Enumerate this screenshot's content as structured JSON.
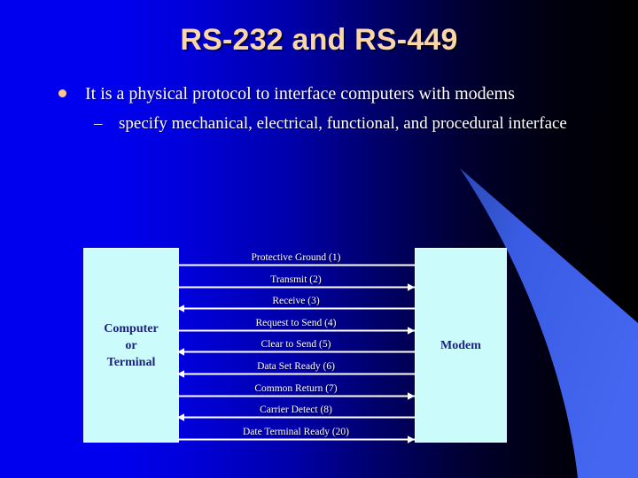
{
  "slide": {
    "title": "RS-232 and RS-449",
    "title_color": "#FBD7A8",
    "background_left_color": "#0000EE",
    "background_right_color": "#000000",
    "accent_wedge_color": "#3B5EE8"
  },
  "body": {
    "bullet_glyph": "bullet-dot",
    "bullet_text": "It is a physical protocol to interface computers with modems",
    "dash_glyph": "–",
    "sub_text": "specify mechanical, electrical, functional, and procedural interface"
  },
  "diagram": {
    "left_box_label": "Computer\nor\nTerminal",
    "left_box_lines": [
      "Computer",
      "or",
      "Terminal"
    ],
    "right_box_label": "Modem",
    "box_fill_color": "#CCFBFB",
    "box_text_color": "#1A237E",
    "line_color": "#FFFFFF",
    "signals": [
      {
        "label": "Protective Ground (1)",
        "pin": "1",
        "direction": "none"
      },
      {
        "label": "Transmit (2)",
        "pin": "2",
        "direction": "right"
      },
      {
        "label": "Receive (3)",
        "pin": "3",
        "direction": "left"
      },
      {
        "label": "Request to Send (4)",
        "pin": "4",
        "direction": "right"
      },
      {
        "label": "Clear to Send (5)",
        "pin": "5",
        "direction": "left"
      },
      {
        "label": "Data Set Ready (6)",
        "pin": "6",
        "direction": "left"
      },
      {
        "label": "Common Return (7)",
        "pin": "7",
        "direction": "right"
      },
      {
        "label": "Carrier Detect (8)",
        "pin": "8",
        "direction": "left"
      },
      {
        "label": "Date Terminal Ready (20)",
        "pin": "20",
        "direction": "right"
      }
    ]
  }
}
